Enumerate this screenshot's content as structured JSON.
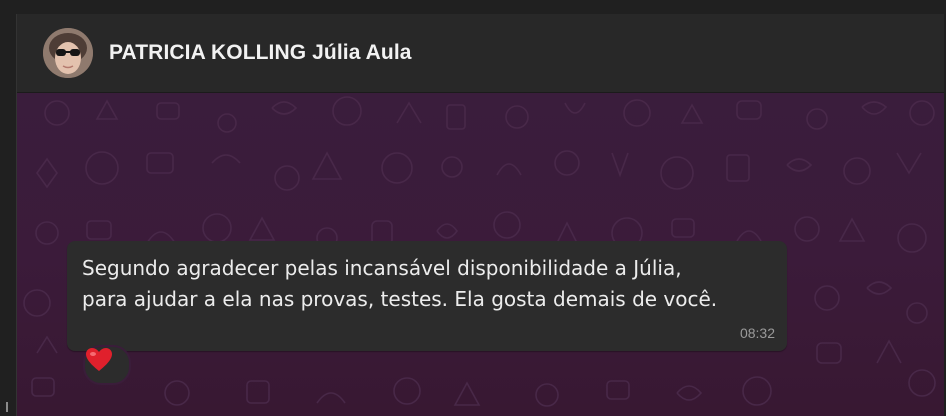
{
  "chat": {
    "contact_name": "PATRICIA KOLLING Júlia Aula",
    "message": {
      "lines": [
        "Segundo agradecer pelas incansável disponibilidade a Júlia,",
        "para ajudar a ela nas provas, testes. Ela gosta demais de você."
      ],
      "time": "08:32",
      "reaction": "red-heart"
    }
  },
  "colors": {
    "wallpaper": "#3a1c3b",
    "bubble": "#2c2c2c",
    "header": "#282828",
    "heart": "#e0202c"
  }
}
